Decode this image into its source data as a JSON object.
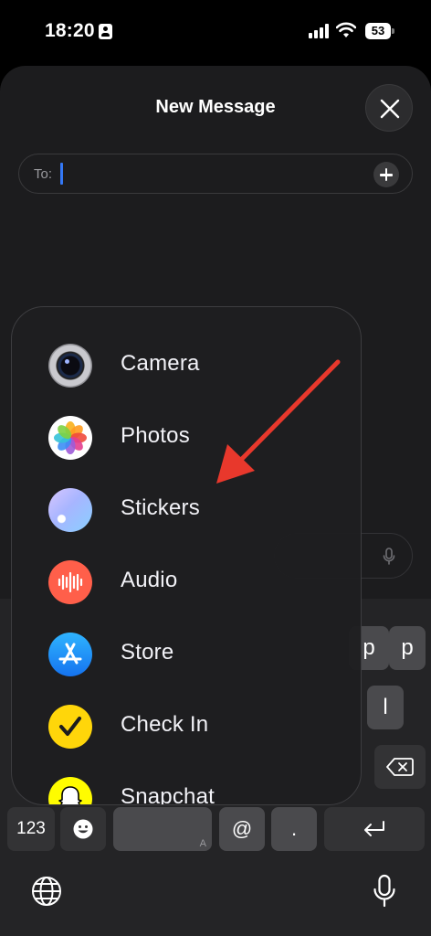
{
  "status_bar": {
    "time": "18:20",
    "battery_level": "53",
    "icons": [
      "id-card-icon",
      "cellular-signal-icon",
      "wifi-icon",
      "battery-icon"
    ]
  },
  "sheet": {
    "title": "New Message",
    "close_icon": "close-icon",
    "to_field": {
      "label": "To:",
      "value": "",
      "add_icon": "plus-circle-icon"
    }
  },
  "app_menu": {
    "items": [
      {
        "label": "Camera",
        "icon": "camera-icon"
      },
      {
        "label": "Photos",
        "icon": "photos-icon"
      },
      {
        "label": "Stickers",
        "icon": "stickers-icon"
      },
      {
        "label": "Audio",
        "icon": "audio-waveform-icon"
      },
      {
        "label": "Store",
        "icon": "app-store-icon"
      },
      {
        "label": "Check In",
        "icon": "checkmark-icon"
      },
      {
        "label": "Snapchat",
        "icon": "snapchat-ghost-icon"
      }
    ]
  },
  "keyboard": {
    "keys": {
      "p": "p",
      "l": "l",
      "numbers": "123",
      "at": "@",
      "dot": ".",
      "space_hint": "A"
    },
    "icons": [
      "emoji-icon",
      "delete-icon",
      "return-icon",
      "globe-icon",
      "microphone-icon"
    ]
  },
  "annotation": {
    "arrow_color": "#e8382c"
  }
}
